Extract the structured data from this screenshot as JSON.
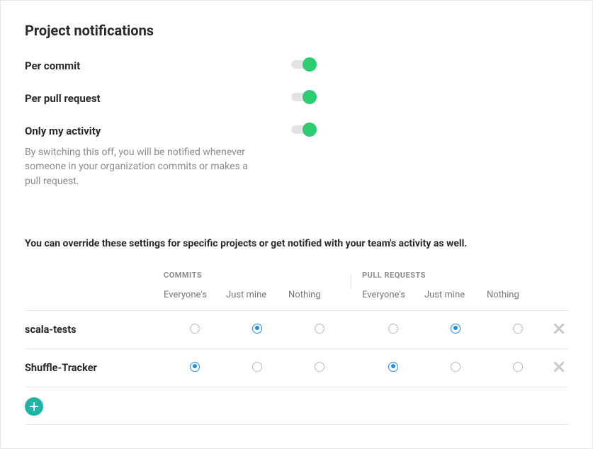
{
  "title": "Project notifications",
  "toggles": {
    "per_commit": {
      "label": "Per commit",
      "on": true
    },
    "per_pull_request": {
      "label": "Per pull request",
      "on": true
    },
    "only_my_activity": {
      "label": "Only my activity",
      "on": true,
      "help": "By switching this off, you will be notified whenever someone in your organization commits or makes a pull request."
    }
  },
  "override_text": "You can override these settings for specific projects or get notified with your team's activity as well.",
  "table": {
    "groups": {
      "commits": "Commits",
      "pull_requests": "Pull Requests"
    },
    "option_labels": {
      "everyones": "Everyone's",
      "just_mine": "Just mine",
      "nothing": "Nothing"
    },
    "rows": [
      {
        "name": "scala-tests",
        "commits": "just_mine",
        "pull_requests": "just_mine"
      },
      {
        "name": "Shuffle-Tracker",
        "commits": "everyones",
        "pull_requests": "everyones"
      }
    ]
  }
}
